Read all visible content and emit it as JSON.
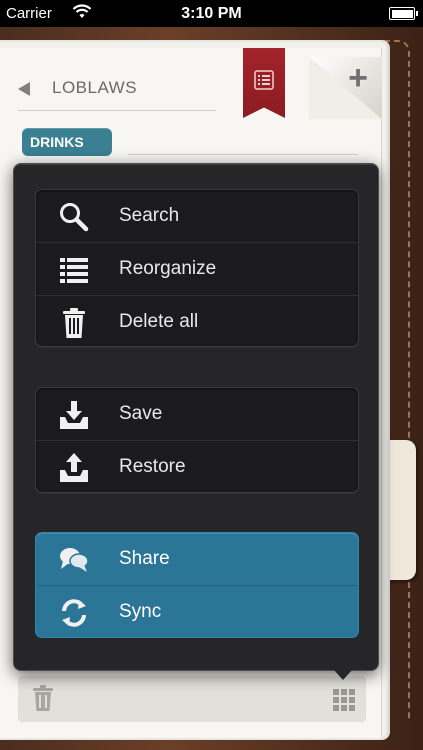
{
  "status_bar": {
    "carrier": "Carrier",
    "time": "3:10 PM"
  },
  "header": {
    "back_label": "LOBLAWS",
    "category_badge": "DRINKS",
    "add_label": "+"
  },
  "menu": {
    "group1": [
      {
        "label": "Search",
        "icon": "search-icon"
      },
      {
        "label": "Reorganize",
        "icon": "list-icon"
      },
      {
        "label": "Delete all",
        "icon": "trash-icon"
      }
    ],
    "group2": [
      {
        "label": "Save",
        "icon": "download-tray-icon"
      },
      {
        "label": "Restore",
        "icon": "upload-tray-icon"
      }
    ],
    "group3": [
      {
        "label": "Share",
        "icon": "speech-bubbles-icon"
      },
      {
        "label": "Sync",
        "icon": "sync-icon"
      }
    ]
  },
  "colors": {
    "accent_blue": "#2b7597",
    "bookmark_red": "#9a2027",
    "badge_teal": "#3b7f93",
    "popover_bg": "#262628"
  }
}
